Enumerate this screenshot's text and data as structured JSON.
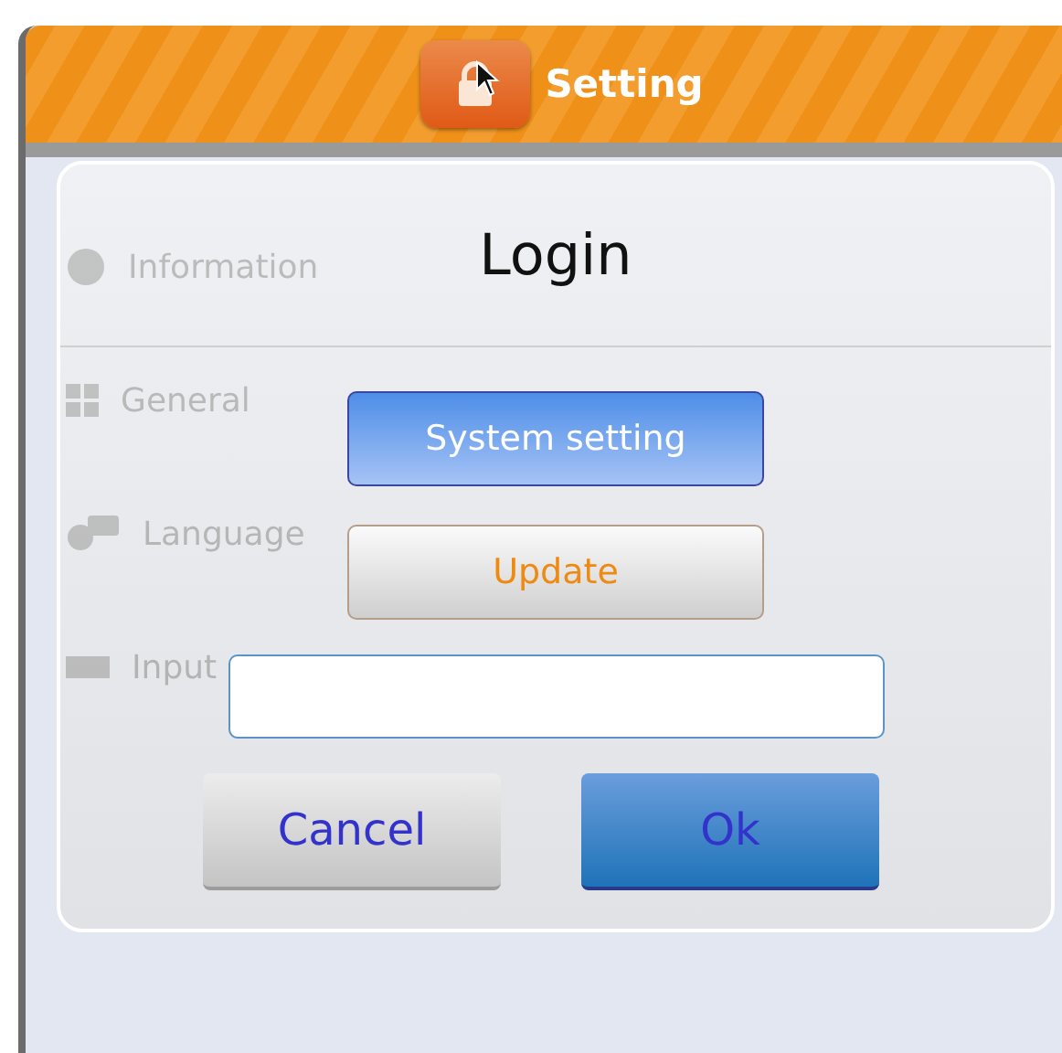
{
  "header": {
    "title": "Setting"
  },
  "sidebar": {
    "items": [
      {
        "label": "Information",
        "kind": "info"
      },
      {
        "label": "General",
        "kind": "grid"
      },
      {
        "label": "Language",
        "kind": "language"
      },
      {
        "label": "Input",
        "kind": "keyboard"
      }
    ]
  },
  "dialog": {
    "title": "Login",
    "options": [
      {
        "label": "System setting",
        "selected": true
      },
      {
        "label": "Update",
        "selected": false
      }
    ],
    "buttons": [
      {
        "label": "Cancel",
        "kind": "secondary"
      },
      {
        "label": "Ok",
        "kind": "primary"
      }
    ]
  }
}
